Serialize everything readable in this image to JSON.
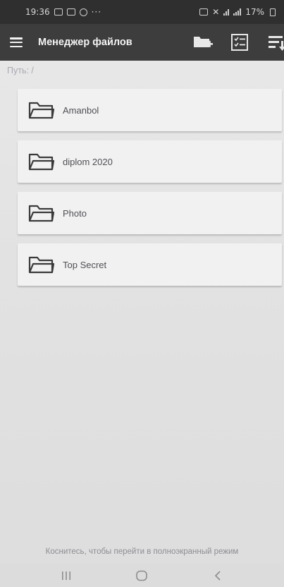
{
  "status_bar": {
    "time": "19:36",
    "battery": "17%",
    "left_icons": [
      "gallery-icon",
      "qr-icon",
      "circle-icon",
      "more-dots-icon"
    ],
    "right_icons": [
      "nfc-icon",
      "mute-icon",
      "wifi-icon",
      "signal-icon",
      "battery-icon"
    ]
  },
  "toolbar": {
    "title": "Менеджер файлов",
    "icons": [
      "menu-icon",
      "new-folder-icon",
      "checklist-icon",
      "sort-icon"
    ]
  },
  "path": {
    "label": "Путь: /"
  },
  "files": [
    {
      "name": "Amanbol",
      "icon": "folder-icon"
    },
    {
      "name": "diplom 2020",
      "icon": "folder-icon"
    },
    {
      "name": "Photo",
      "icon": "folder-icon"
    },
    {
      "name": "Top Secret",
      "icon": "folder-icon"
    }
  ],
  "hint": {
    "text": "Коснитесь, чтобы перейти в полноэкранный режим"
  },
  "navigation": {
    "buttons": [
      "recent-apps-icon",
      "home-icon",
      "back-icon"
    ]
  },
  "colors": {
    "toolbar": "#3d3d3d",
    "status_bar": "#2f2f2f",
    "background": "#e6e6e6",
    "card": "#f1f1f1",
    "text": "#505056"
  }
}
